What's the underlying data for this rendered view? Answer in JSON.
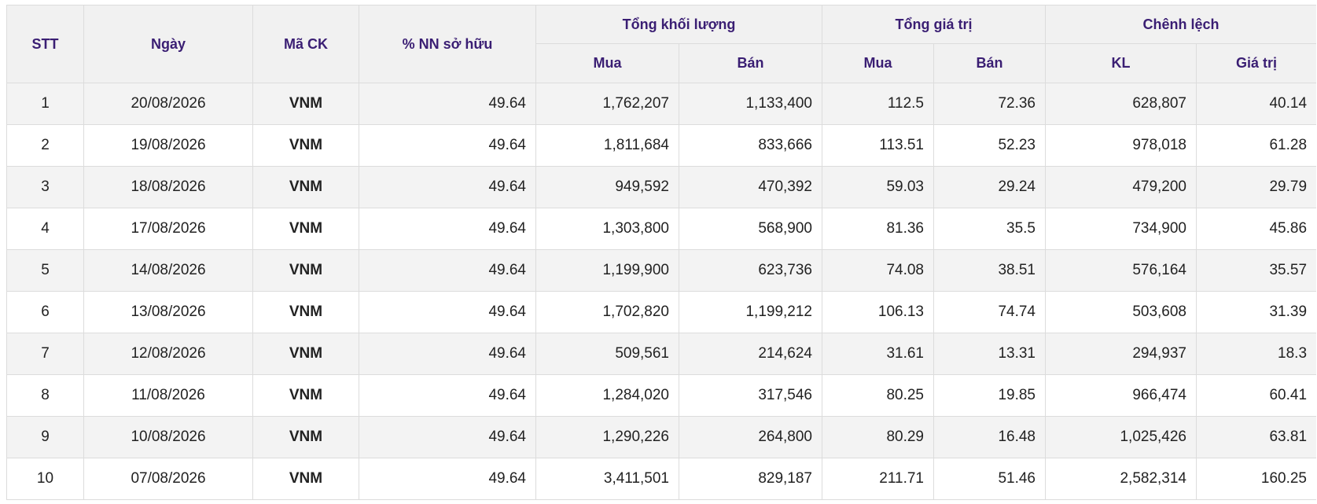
{
  "table": {
    "headers": {
      "stt": "STT",
      "date": "Ngày",
      "symbol": "Mã CK",
      "foreign_pct": "% NN sở hữu",
      "total_volume": "Tổng khối lượng",
      "total_value": "Tổng giá trị",
      "difference": "Chênh lệch",
      "buy": "Mua",
      "sell": "Bán",
      "kl": "KL",
      "value": "Giá trị"
    },
    "rows": [
      {
        "stt": "1",
        "date": "20/08/2026",
        "symbol": "VNM",
        "pct": "49.64",
        "vol_buy": "1,762,207",
        "vol_sell": "1,133,400",
        "val_buy": "112.5",
        "val_sell": "72.36",
        "diff_kl": "628,807",
        "diff_val": "40.14"
      },
      {
        "stt": "2",
        "date": "19/08/2026",
        "symbol": "VNM",
        "pct": "49.64",
        "vol_buy": "1,811,684",
        "vol_sell": "833,666",
        "val_buy": "113.51",
        "val_sell": "52.23",
        "diff_kl": "978,018",
        "diff_val": "61.28"
      },
      {
        "stt": "3",
        "date": "18/08/2026",
        "symbol": "VNM",
        "pct": "49.64",
        "vol_buy": "949,592",
        "vol_sell": "470,392",
        "val_buy": "59.03",
        "val_sell": "29.24",
        "diff_kl": "479,200",
        "diff_val": "29.79"
      },
      {
        "stt": "4",
        "date": "17/08/2026",
        "symbol": "VNM",
        "pct": "49.64",
        "vol_buy": "1,303,800",
        "vol_sell": "568,900",
        "val_buy": "81.36",
        "val_sell": "35.5",
        "diff_kl": "734,900",
        "diff_val": "45.86"
      },
      {
        "stt": "5",
        "date": "14/08/2026",
        "symbol": "VNM",
        "pct": "49.64",
        "vol_buy": "1,199,900",
        "vol_sell": "623,736",
        "val_buy": "74.08",
        "val_sell": "38.51",
        "diff_kl": "576,164",
        "diff_val": "35.57"
      },
      {
        "stt": "6",
        "date": "13/08/2026",
        "symbol": "VNM",
        "pct": "49.64",
        "vol_buy": "1,702,820",
        "vol_sell": "1,199,212",
        "val_buy": "106.13",
        "val_sell": "74.74",
        "diff_kl": "503,608",
        "diff_val": "31.39"
      },
      {
        "stt": "7",
        "date": "12/08/2026",
        "symbol": "VNM",
        "pct": "49.64",
        "vol_buy": "509,561",
        "vol_sell": "214,624",
        "val_buy": "31.61",
        "val_sell": "13.31",
        "diff_kl": "294,937",
        "diff_val": "18.3"
      },
      {
        "stt": "8",
        "date": "11/08/2026",
        "symbol": "VNM",
        "pct": "49.64",
        "vol_buy": "1,284,020",
        "vol_sell": "317,546",
        "val_buy": "80.25",
        "val_sell": "19.85",
        "diff_kl": "966,474",
        "diff_val": "60.41"
      },
      {
        "stt": "9",
        "date": "10/08/2026",
        "symbol": "VNM",
        "pct": "49.64",
        "vol_buy": "1,290,226",
        "vol_sell": "264,800",
        "val_buy": "80.29",
        "val_sell": "16.48",
        "diff_kl": "1,025,426",
        "diff_val": "63.81"
      },
      {
        "stt": "10",
        "date": "07/08/2026",
        "symbol": "VNM",
        "pct": "49.64",
        "vol_buy": "3,411,501",
        "vol_sell": "829,187",
        "val_buy": "211.71",
        "val_sell": "51.46",
        "diff_kl": "2,582,314",
        "diff_val": "160.25"
      }
    ]
  },
  "colors": {
    "header_text": "#3a1e73",
    "header_bg": "#f1f1f1",
    "row_alt_bg": "#f3f3f3",
    "border": "#dcdcdc"
  }
}
